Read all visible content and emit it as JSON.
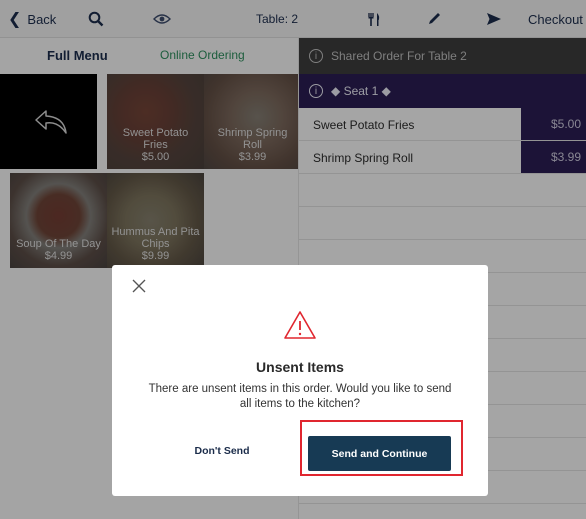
{
  "toolbar": {
    "back_label": "Back",
    "table_label": "Table: 2",
    "checkout_label": "Checkout"
  },
  "menu": {
    "tab_full": "Full Menu",
    "tab_online": "Online Ordering",
    "items": [
      {
        "name": "Sweet Potato Fries",
        "price": "$5.00",
        "icon": "fries-photo"
      },
      {
        "name": "Shrimp Spring Roll",
        "price": "$3.99",
        "icon": "spring-roll-photo"
      },
      {
        "name": "Soup Of The Day",
        "price": "$4.99",
        "icon": "soup-photo"
      },
      {
        "name": "Hummus And Pita Chips",
        "price": "$9.99",
        "icon": "hummus-photo"
      }
    ]
  },
  "order": {
    "header": "Shared Order For Table 2",
    "seat": "◆ Seat 1 ◆",
    "lines": [
      {
        "name": "Sweet Potato Fries",
        "price": "$5.00"
      },
      {
        "name": "Shrimp Spring Roll",
        "price": "$3.99"
      }
    ]
  },
  "dialog": {
    "title": "Unsent Items",
    "message": "There are unsent items in this order. Would you like to send all items to the kitchen?",
    "dont_send": "Don't Send",
    "send_continue": "Send and Continue"
  },
  "colors": {
    "seat_bar": "#2a1d52",
    "primary_button": "#173a54",
    "highlight_outline": "#e0262f",
    "online_tab": "#2b8a5a"
  }
}
